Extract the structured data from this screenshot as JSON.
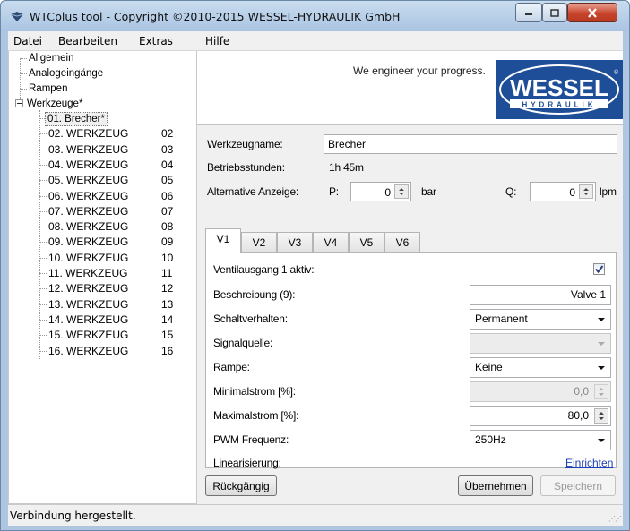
{
  "window": {
    "title": "WTCplus tool - Copyright ©2010-2015 WESSEL-HYDRAULIK GmbH"
  },
  "menu": [
    "Datei",
    "Bearbeiten",
    "Extras",
    "Hilfe"
  ],
  "tree": {
    "items": [
      "Allgemein",
      "Analogeingänge",
      "Rampen"
    ],
    "group": "Werkzeuge*",
    "tools": [
      {
        "label": "01. Brecher*",
        "code": ""
      },
      {
        "label": "02. WERKZEUG",
        "code": "02"
      },
      {
        "label": "03. WERKZEUG",
        "code": "03"
      },
      {
        "label": "04. WERKZEUG",
        "code": "04"
      },
      {
        "label": "05. WERKZEUG",
        "code": "05"
      },
      {
        "label": "06. WERKZEUG",
        "code": "06"
      },
      {
        "label": "07. WERKZEUG",
        "code": "07"
      },
      {
        "label": "08. WERKZEUG",
        "code": "08"
      },
      {
        "label": "09. WERKZEUG",
        "code": "09"
      },
      {
        "label": "10. WERKZEUG",
        "code": "10"
      },
      {
        "label": "11. WERKZEUG",
        "code": "11"
      },
      {
        "label": "12. WERKZEUG",
        "code": "12"
      },
      {
        "label": "13. WERKZEUG",
        "code": "13"
      },
      {
        "label": "14. WERKZEUG",
        "code": "14"
      },
      {
        "label": "15. WERKZEUG",
        "code": "15"
      },
      {
        "label": "16. WERKZEUG",
        "code": "16"
      }
    ]
  },
  "header": {
    "slogan": "We engineer your progress.",
    "logo_main": "WESSEL",
    "logo_sub": "HYDRAULIK",
    "logo_reg": "®"
  },
  "form": {
    "name_label": "Werkzeugname:",
    "name_value": "Brecher",
    "hours_label": "Betriebsstunden:",
    "hours_value": "1h 45m",
    "alt_label": "Alternative Anzeige:",
    "p_label": "P:",
    "p_value": "0",
    "p_unit": "bar",
    "q_label": "Q:",
    "q_value": "0",
    "q_unit": "lpm"
  },
  "tabs": [
    "V1",
    "V2",
    "V3",
    "V4",
    "V5",
    "V6"
  ],
  "valve": {
    "active_label": "Ventilausgang 1 aktiv:",
    "active_checked": true,
    "desc_label": "Beschreibung (9):",
    "desc_value": "Valve 1",
    "switch_label": "Schaltverhalten:",
    "switch_value": "Permanent",
    "signal_label": "Signalquelle:",
    "signal_value": "",
    "ramp_label": "Rampe:",
    "ramp_value": "Keine",
    "min_label": "Minimalstrom [%]:",
    "min_value": "0,0",
    "max_label": "Maximalstrom [%]:",
    "max_value": "80,0",
    "pwm_label": "PWM Frequenz:",
    "pwm_value": "250Hz",
    "lin_label": "Linearisierung:",
    "lin_link": "Einrichten"
  },
  "buttons": {
    "undo": "Rückgängig",
    "apply": "Übernehmen",
    "save": "Speichern"
  },
  "status": "Verbindung hergestellt."
}
